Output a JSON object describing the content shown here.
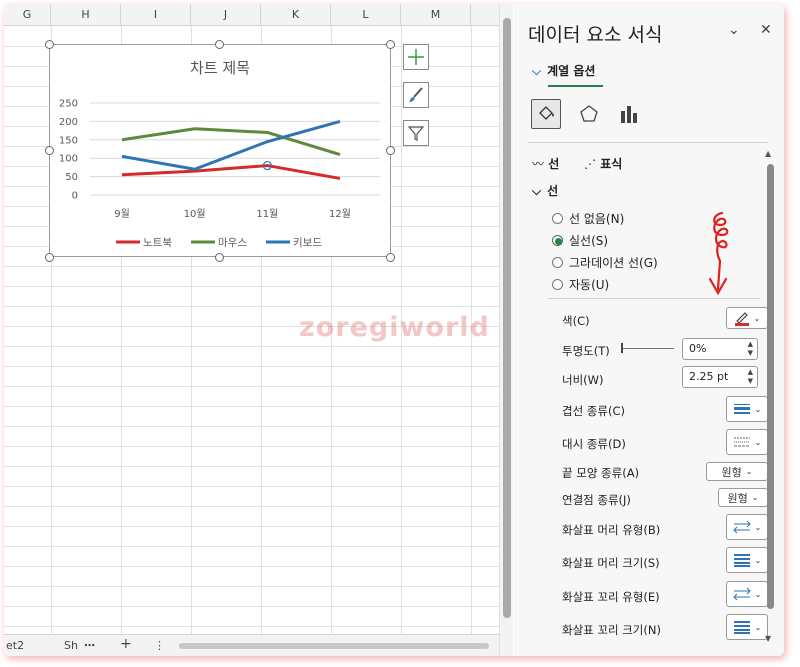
{
  "columns": [
    "G",
    "H",
    "I",
    "J",
    "K",
    "L",
    "M"
  ],
  "chart": {
    "title": "차트 제목",
    "legend": [
      "노트북",
      "마우스",
      "키보드"
    ]
  },
  "chart_data": {
    "type": "line",
    "title": "차트 제목",
    "categories": [
      "9월",
      "10월",
      "11월",
      "12월"
    ],
    "y_ticks": [
      "250",
      "200",
      "150",
      "100",
      "50",
      "0"
    ],
    "ylim": [
      0,
      250
    ],
    "grid": true,
    "legend_position": "bottom",
    "series": [
      {
        "name": "노트북",
        "color": "#d42b2b",
        "values": [
          55,
          65,
          80,
          45
        ]
      },
      {
        "name": "마우스",
        "color": "#5c8a3a",
        "values": [
          150,
          180,
          170,
          110
        ]
      },
      {
        "name": "키보드",
        "color": "#2f75b5",
        "values": [
          105,
          70,
          145,
          200
        ]
      }
    ]
  },
  "sheet_bottom": {
    "sheet_tab_partial": "et2",
    "sheet_tab2": "Sh",
    "more": "⋯",
    "add": "+",
    "menu": "⋮"
  },
  "pane": {
    "title": "데이터 요소 서식",
    "series_options": "계열 옵션",
    "subtab_line": "선",
    "subtab_marker": "표식",
    "section_line": "선",
    "radios": [
      {
        "label": "선 없음(N)",
        "selected": false
      },
      {
        "label": "실선(S)",
        "selected": true
      },
      {
        "label": "그라데이션 선(G)",
        "selected": false
      },
      {
        "label": "자동(U)",
        "selected": false
      }
    ],
    "props": {
      "color": "색(C)",
      "transparency": "투명도(T)",
      "width": "너비(W)",
      "compound": "겹선 종류(C)",
      "dash": "대시 종류(D)",
      "cap": "끝 모양 종류(A)",
      "join": "연결점 종류(J)",
      "begin_arrow_type": "화살표 머리 유형(B)",
      "begin_arrow_size": "화살표 머리 크기(S)",
      "end_arrow_type": "화살표 꼬리 유형(E)",
      "end_arrow_size": "화살표 꼬리 크기(N)"
    },
    "values": {
      "transparency": "0%",
      "width": "2.25 pt",
      "cap": "원형",
      "join": "원형"
    },
    "line_color": "#d42b2b",
    "accent": "#2e7d4f"
  },
  "watermark": "zoregiworld"
}
